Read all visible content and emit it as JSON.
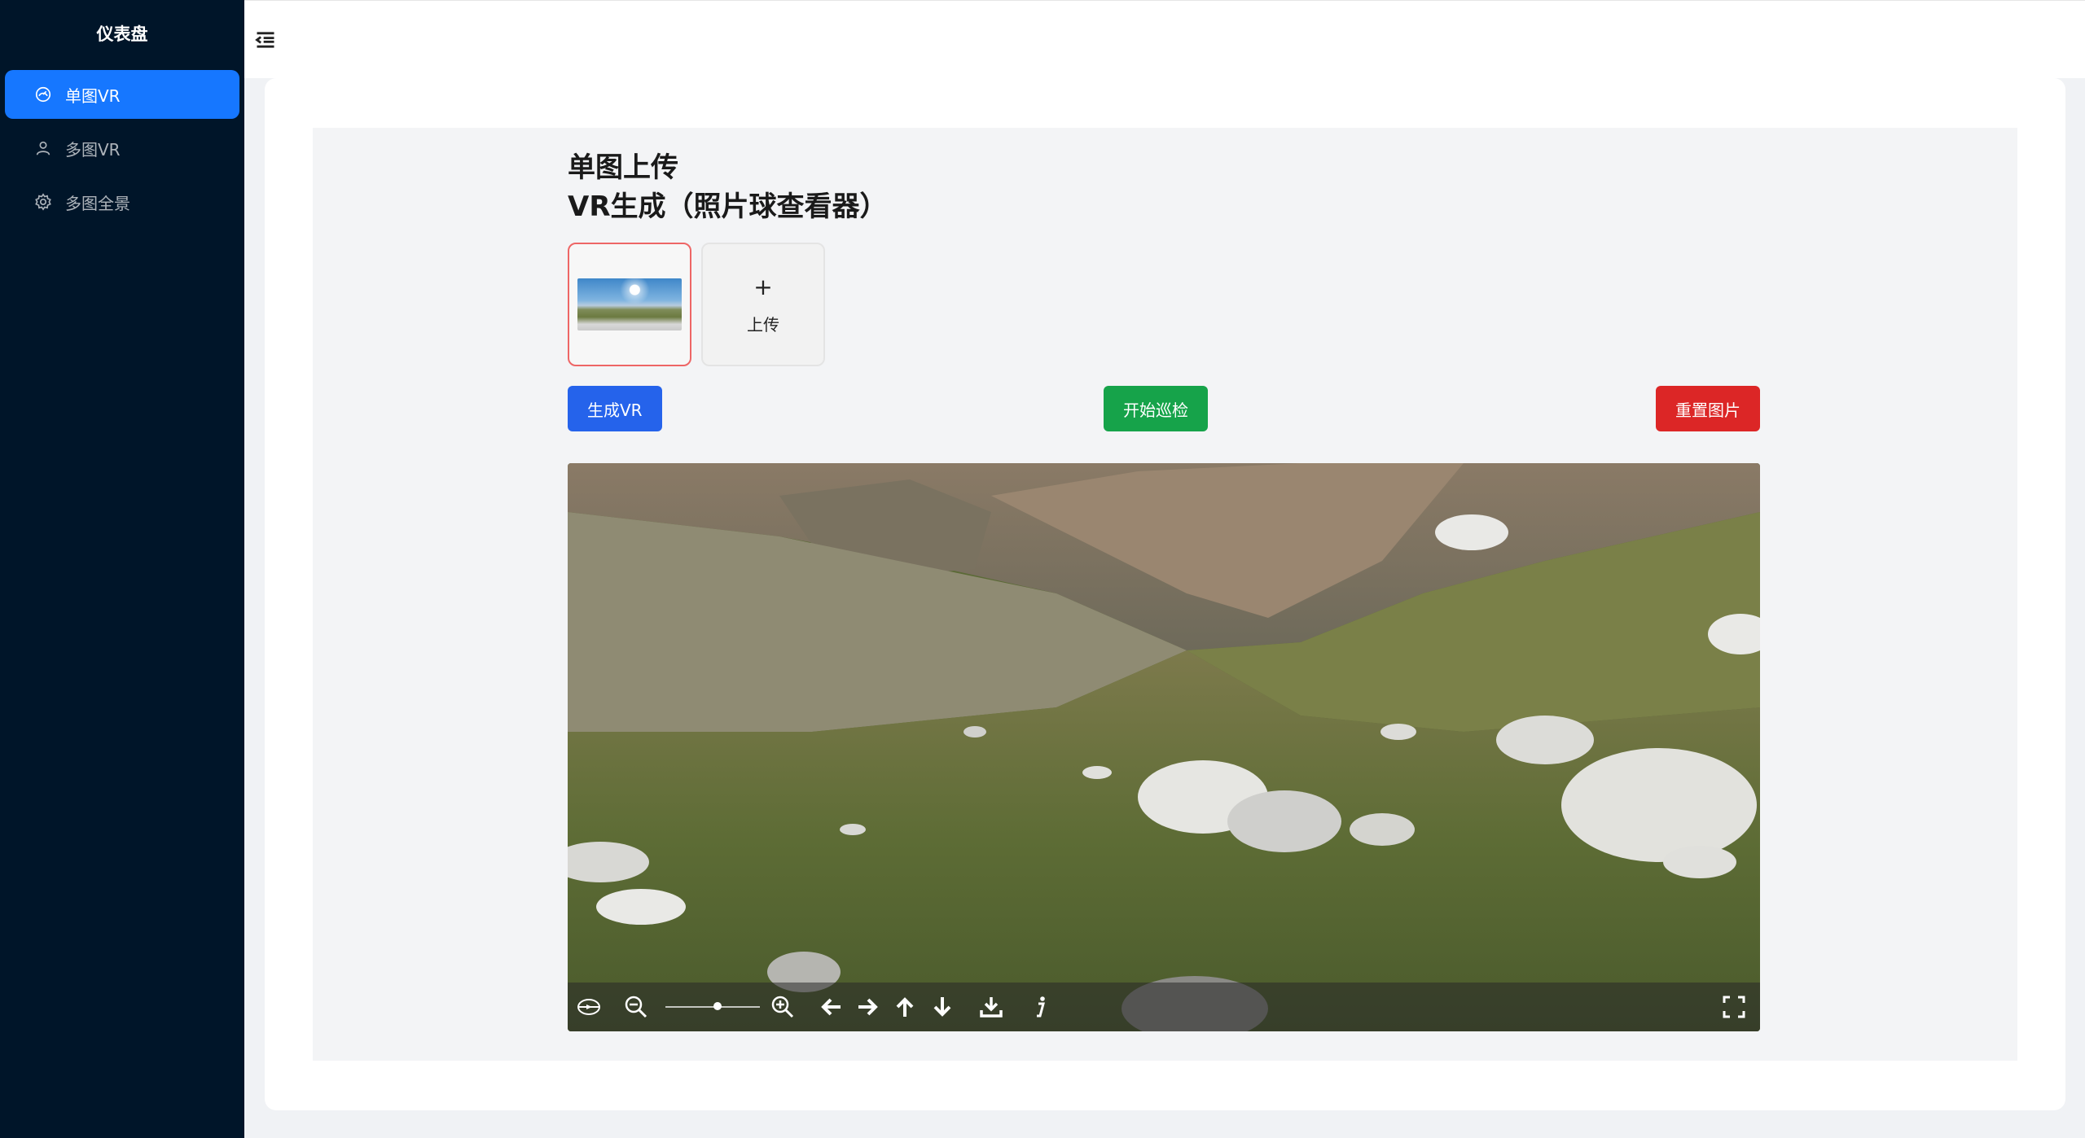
{
  "sidebar": {
    "title": "仪表盘",
    "items": [
      {
        "label": "单图VR",
        "icon": "dashboard-icon",
        "active": true
      },
      {
        "label": "多图VR",
        "icon": "user-icon",
        "active": false
      },
      {
        "label": "多图全景",
        "icon": "gear-icon",
        "active": false
      }
    ]
  },
  "header": {
    "collapse_icon": "menu-fold-icon"
  },
  "main": {
    "title_line1": "单图上传",
    "title_line2": "VR生成（照片球查看器）",
    "upload": {
      "plus": "+",
      "label": "上传"
    },
    "buttons": {
      "generate": "生成VR",
      "patrol": "开始巡检",
      "reset": "重置图片"
    }
  },
  "viewer": {
    "zoom_level": 0.55,
    "navbar_icons": [
      "autorotate-icon",
      "zoom-out-icon",
      "zoom-in-icon",
      "arrow-left-icon",
      "arrow-right-icon",
      "arrow-up-icon",
      "arrow-down-icon",
      "download-icon",
      "info-icon",
      "fullscreen-icon"
    ]
  },
  "colors": {
    "sidebar_bg": "#001529",
    "active": "#1677ff",
    "blue": "#2563eb",
    "green": "#16a34a",
    "red": "#dc2626"
  }
}
